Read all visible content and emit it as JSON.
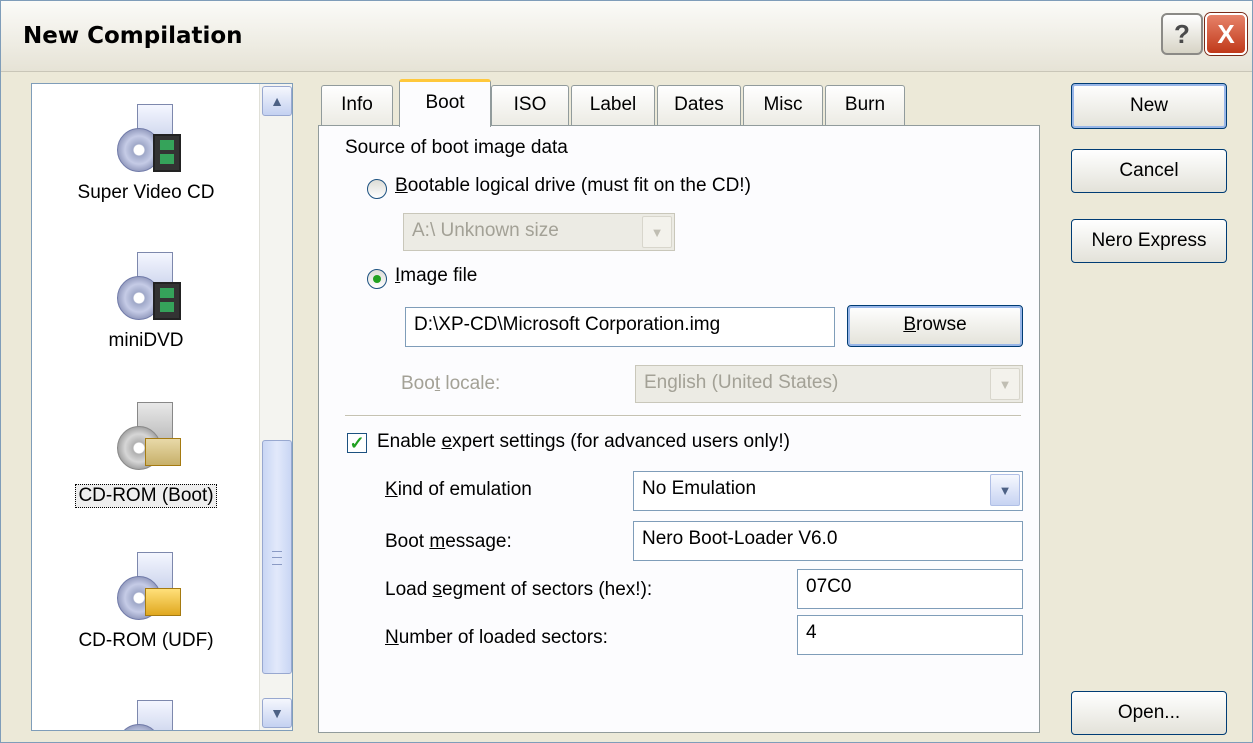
{
  "window": {
    "title": "New Compilation",
    "help": "?",
    "close": "X"
  },
  "compilation_list": {
    "items": [
      {
        "label": "Super Video CD",
        "icon": "svcd-icon",
        "selected": false
      },
      {
        "label": "miniDVD",
        "icon": "minidvd-icon",
        "selected": false
      },
      {
        "label": "CD-ROM (Boot)",
        "icon": "cdrom-boot-icon",
        "selected": true
      },
      {
        "label": "CD-ROM (UDF)",
        "icon": "cdrom-udf-icon",
        "selected": false
      }
    ],
    "scroll_up": "▲",
    "scroll_down": "▼"
  },
  "tabs": [
    {
      "label": "Info"
    },
    {
      "label": "Boot",
      "active": true
    },
    {
      "label": "ISO"
    },
    {
      "label": "Label"
    },
    {
      "label": "Dates"
    },
    {
      "label": "Misc"
    },
    {
      "label": "Burn"
    }
  ],
  "boot": {
    "source_heading": "Source of boot image data",
    "bootable_drive": {
      "pre": "",
      "ul": "B",
      "post": "ootable logical drive (must fit on the CD!)",
      "selected": false
    },
    "drive_select": {
      "value": "A:\\  Unknown size"
    },
    "image_file": {
      "ul": "I",
      "post": "mage file",
      "selected": true
    },
    "image_path": "D:\\XP-CD\\Microsoft Corporation.img",
    "browse": {
      "ul": "B",
      "post": "rowse"
    },
    "boot_locale": {
      "pre": "Boo",
      "ul": "t",
      "post": " locale:",
      "value": "English (United States)"
    },
    "expert": {
      "pre": "Enable ",
      "ul": "e",
      "post": "xpert settings (for advanced users only!)",
      "checked": true
    },
    "emulation": {
      "ul": "K",
      "post": "ind of emulation",
      "value": "No Emulation"
    },
    "boot_message": {
      "pre": "Boot ",
      "ul": "m",
      "post": "essage:",
      "value": "Nero Boot-Loader V6.0"
    },
    "load_segment": {
      "pre": "Load ",
      "ul": "s",
      "post": "egment of sectors (hex!):",
      "value": "07C0"
    },
    "loaded_sectors": {
      "ul": "N",
      "post": "umber of loaded sectors:",
      "value": "4"
    }
  },
  "buttons": {
    "new": "New",
    "cancel": "Cancel",
    "nero_express": "Nero Express",
    "open": "Open..."
  },
  "colors": {
    "accent_tab": "#ffc83c",
    "check_green": "#21a121",
    "window_bg": "#ece9d8"
  }
}
